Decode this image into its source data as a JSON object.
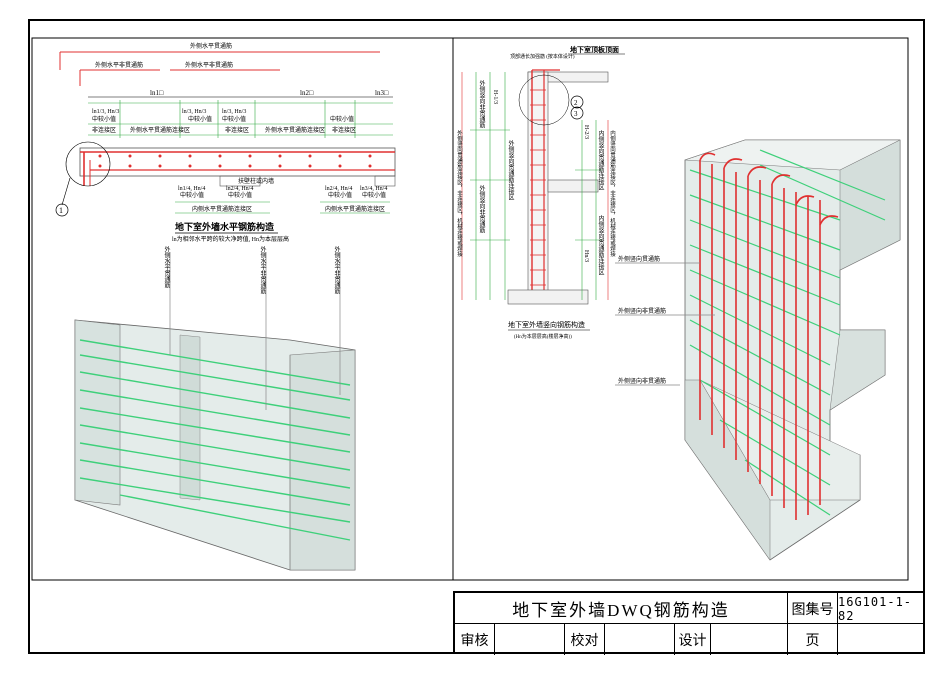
{
  "title_block": {
    "main_title": "地下室外墙DWQ钢筋构造",
    "set_label": "图集号",
    "set_value": "16G101-1-82",
    "review_label": "审核",
    "check_label": "校对",
    "design_label": "设计",
    "page_label": "页"
  },
  "left_detail": {
    "outer_h_label": "外侧水平贯通筋",
    "outer_h_non_label": "外侧水平非贯通筋",
    "outer_h_non_label2": "外侧水平非贯通筋",
    "span_1": "ln1□",
    "span_2": "ln2□",
    "span_3": "ln3□",
    "dim_a1": "ln1/3, Hn/3",
    "dim_a2": "中较小值",
    "dim_b1": "ln/3, Hn/3",
    "dim_b2": "中较小值",
    "dim_c1": "ln/3, Hn/3",
    "dim_c2": "中较小值",
    "zone_non": "非连接区",
    "zone_outer_conn": "外侧水平贯通筋连接区",
    "zone_non2": "非连接区",
    "zone_outer_conn2": "外侧水平贯通筋连接区",
    "zone_non3": "非连接区",
    "inner_anchor": "扶壁柱或内墙",
    "dim_d1": "ln1/4, Hn/4",
    "dim_d2": "中较小值",
    "dim_e1": "ln2/4, Hn/4",
    "dim_e2": "中较小值",
    "dim_f1": "ln2/4, Hn/4",
    "dim_f2": "中较小值",
    "dim_g1": "ln3/4, Hn/4",
    "dim_g2": "中较小值",
    "zone_inner_1": "内侧水平贯通筋连接区",
    "zone_inner_2": "内侧水平贯通筋连接区",
    "zone_inner_3": "内侧水平贯通筋连接区",
    "callout_num": "1",
    "heading": "地下室外墙水平钢筋构造",
    "note": "ln为相邻水平跨的较大净跨值, Hn为本层层高",
    "leader_1": "外侧水平贯通筋",
    "leader_2": "外侧水平非贯通筋",
    "leader_3": "外侧水平非贯通筋"
  },
  "right_detail": {
    "top_label": "地下室顶板顶面",
    "top_note": "顶部通长加强筋 (按本体设计)",
    "heading": "地下室外墙竖向钢筋构造",
    "heading_note": "(Hn为本层层高(楼层净高))",
    "dim_h_top": "H-1/3",
    "dim_h_mid": "H-2/3",
    "dim_h_low": "Hn/3",
    "left_zone_1": "外侧竖向非贯通筋",
    "left_zone_2": "外侧竖向贯通筋连接区",
    "left_zone_3": "外侧竖向非贯通筋",
    "left_long": "外侧竖向贯通筋连接区，非连接区，机械连接或焊接",
    "right_zone_1": "内侧竖向贯通筋连接区",
    "right_zone_2": "内侧竖向贯通筋连接区",
    "right_long": "内侧竖向贯通筋连接区，非连接区，机械连接或焊接",
    "callout_2": "2",
    "callout_3": "3",
    "leader_a": "外侧竖向贯通筋",
    "leader_b": "外侧竖向非贯通筋",
    "leader_c": "外侧竖向非贯通筋",
    "inner_label": "内侧竖向贯通筋"
  }
}
